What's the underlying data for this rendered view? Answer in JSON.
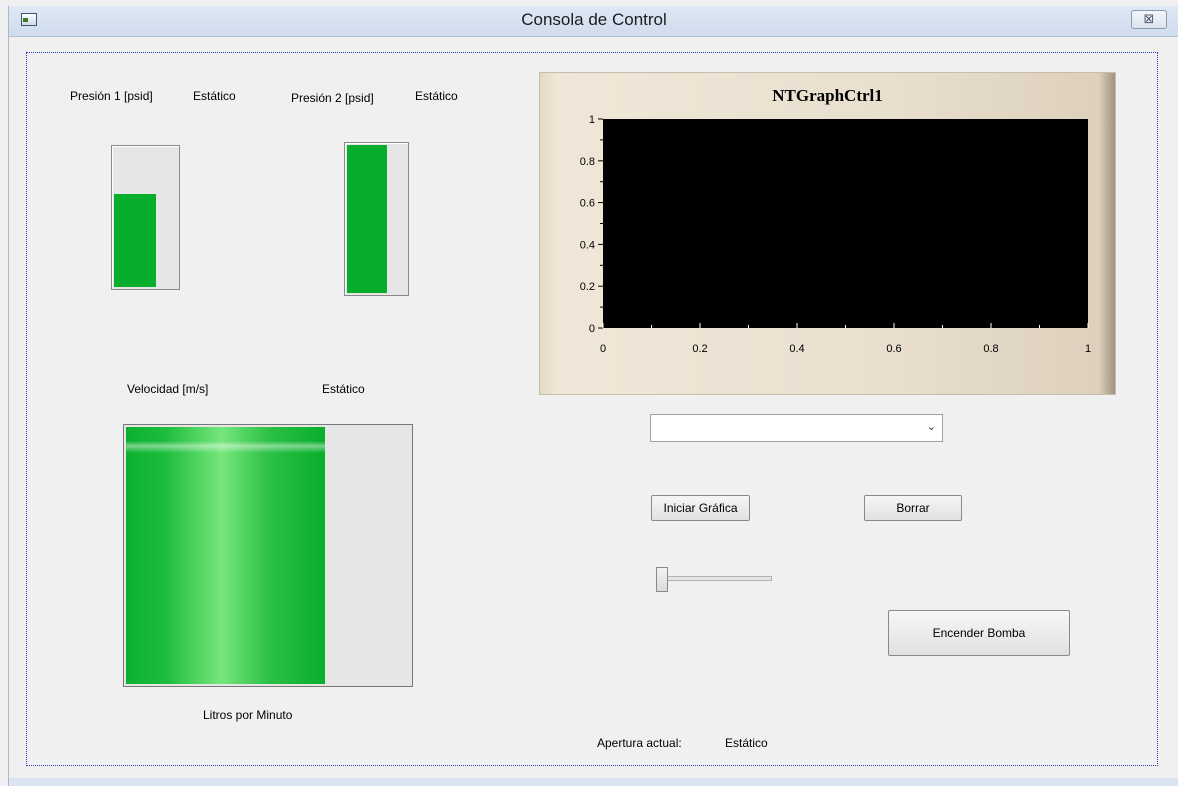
{
  "window": {
    "title": "Consola de Control",
    "close_glyph": "⊠",
    "system_icon": "window-icon",
    "close_icon": "close-icon"
  },
  "pressure1": {
    "label": "Presión 1 [psid]",
    "status": "Estático",
    "level": 0.67
  },
  "pressure2": {
    "label": "Presión 2 [psid]",
    "status": "Estático",
    "level": 1.0
  },
  "velocity": {
    "label": "Velocidad [m/s]",
    "status": "Estático",
    "level": 0.7,
    "caption": "Litros por Minuto"
  },
  "chart_data": {
    "type": "line",
    "title": "NTGraphCtrl1",
    "x": [],
    "series": [],
    "xlim": [
      0,
      1
    ],
    "ylim": [
      0,
      1
    ],
    "x_ticks": [
      "0",
      "0.2",
      "0.4",
      "0.6",
      "0.8",
      "1"
    ],
    "y_ticks": [
      "0",
      "0.2",
      "0.4",
      "0.6",
      "0.8",
      "1"
    ],
    "plot_background": "#000000",
    "frame_color": "#e9dfcf"
  },
  "combo": {
    "value": "",
    "arrow": "⌄"
  },
  "buttons": {
    "start_graph": "Iniciar Gráfica",
    "clear": "Borrar",
    "pump_on": "Encender Bomba"
  },
  "slider": {
    "value": 0.0
  },
  "aperture": {
    "label": "Apertura actual:",
    "value": "Estático"
  },
  "colors": {
    "gauge_fill": "#06ae2b",
    "gauge_bg": "#e6e6e6"
  }
}
